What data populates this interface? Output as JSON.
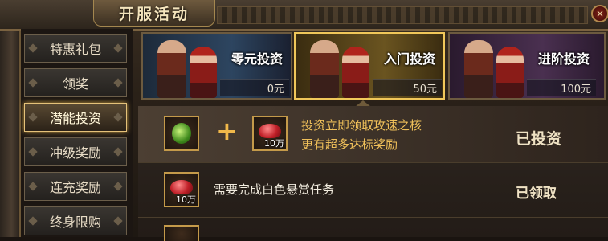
{
  "window": {
    "title": "开服活动",
    "close_label": "×"
  },
  "sidebar": {
    "items": [
      {
        "label": "特惠礼包"
      },
      {
        "label": "领奖"
      },
      {
        "label": "潜能投资",
        "active": true
      },
      {
        "label": "冲级奖励"
      },
      {
        "label": "连充奖励"
      },
      {
        "label": "终身限购"
      }
    ]
  },
  "tiers": [
    {
      "name": "零元投资",
      "price": "0元",
      "bg": "#2d4560"
    },
    {
      "name": "入门投资",
      "price": "50元",
      "bg": "#6a5420",
      "selected": true
    },
    {
      "name": "进阶投资",
      "price": "100元",
      "bg": "#4a3050"
    }
  ],
  "rewards": [
    {
      "items": [
        {
          "type": "green-core-icon",
          "qty": ""
        },
        {
          "type": "red-gem-icon",
          "qty": "10万"
        }
      ],
      "desc_line1": "投资立即领取攻速之核",
      "desc_line2": "更有超多达标奖励",
      "status": "已投资"
    },
    {
      "items": [
        {
          "type": "red-gem-icon",
          "qty": "10万"
        }
      ],
      "desc_line1": "需要完成白色悬赏任务",
      "status": "已领取"
    }
  ],
  "colors": {
    "accent_gold": "#f0c05a",
    "active_border": "#e5c27a"
  }
}
